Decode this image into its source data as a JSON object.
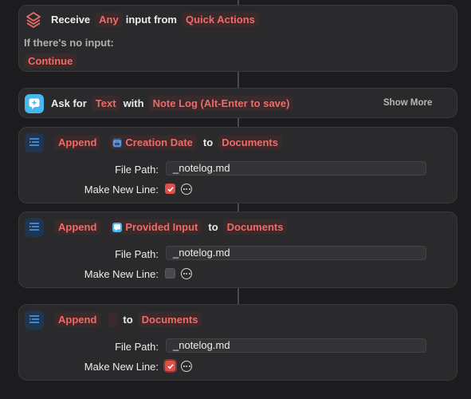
{
  "receive": {
    "label": "Receive",
    "type": "Any",
    "mid": "input from",
    "source": "Quick Actions",
    "no_input_label": "If there's no input:",
    "no_input_action": "Continue",
    "icon": "layers-stack-icon"
  },
  "ask": {
    "label": "Ask for",
    "type": "Text",
    "mid": "with",
    "prompt": "Note Log (Alt-Enter to save)",
    "show_more": "Show More",
    "icon": "text-bubble-icon"
  },
  "appends": [
    {
      "verb": "Append",
      "variable": "Creation Date",
      "to": "to",
      "destination": "Documents",
      "file_path_label": "File Path:",
      "file_path": "_notelog.md",
      "new_line_label": "Make New Line:",
      "new_line_checked": true,
      "icon": "append-text-icon"
    },
    {
      "verb": "Append",
      "variable": "Provided Input",
      "to": "to",
      "destination": "Documents",
      "file_path_label": "File Path:",
      "file_path": "_notelog.md",
      "new_line_label": "Make New Line:",
      "new_line_checked": false,
      "icon": "append-text-icon"
    },
    {
      "verb": "Append",
      "variable": "",
      "to": "to",
      "destination": "Documents",
      "file_path_label": "File Path:",
      "file_path": "_notelog.md",
      "new_line_label": "Make New Line:",
      "new_line_checked": true,
      "icon": "append-text-icon"
    }
  ],
  "colors": {
    "background": "#1c1c1e",
    "card": "#2a2a2c",
    "accent": "#ef6b68",
    "checkbox_on": "#e0504a"
  }
}
